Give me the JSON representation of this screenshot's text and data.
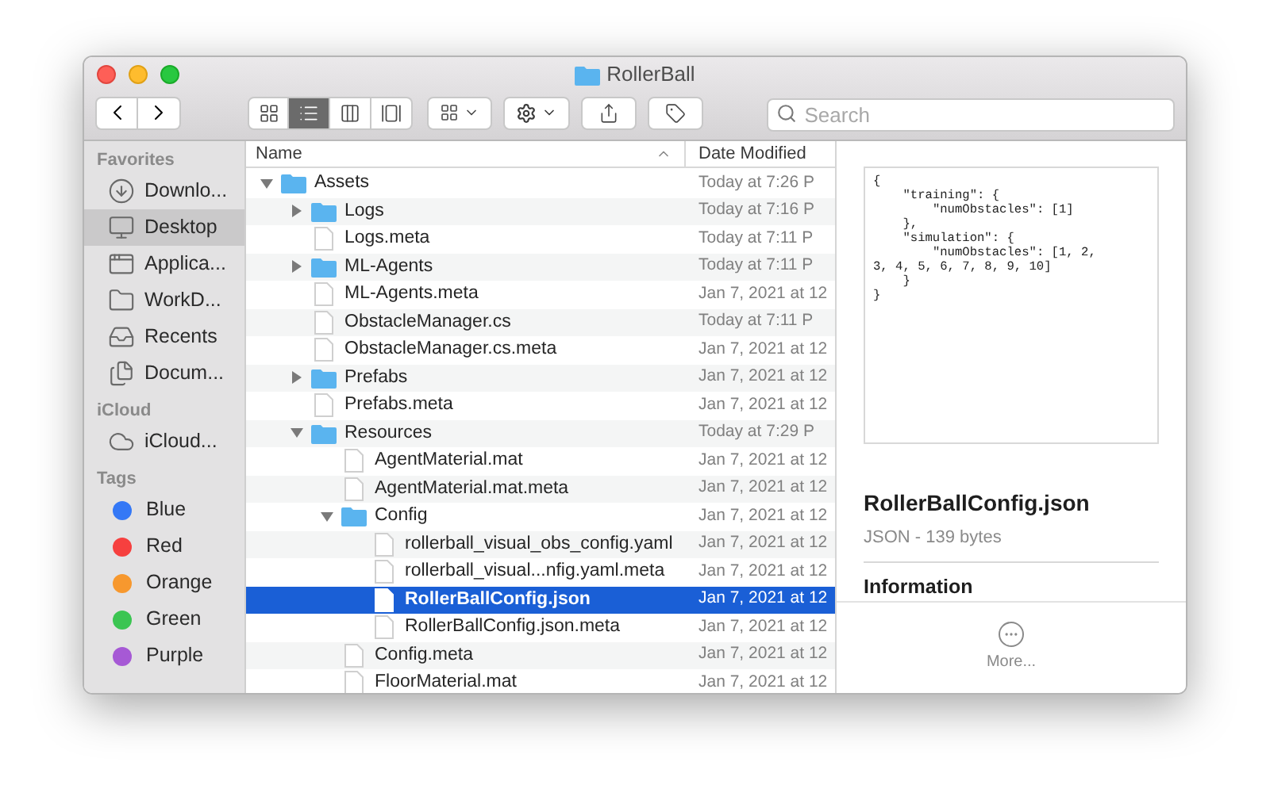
{
  "window": {
    "title": "RollerBall"
  },
  "toolbar": {
    "view_modes": [
      {
        "selected": false
      },
      {
        "selected": true
      },
      {
        "selected": false
      },
      {
        "selected": false
      }
    ],
    "search": {
      "placeholder": "Search"
    }
  },
  "sidebar": {
    "sections": [
      {
        "heading": "Favorites",
        "items": [
          {
            "label": "Downlo...",
            "kind": "downloads",
            "selected": false
          },
          {
            "label": "Desktop",
            "kind": "desktop",
            "selected": true
          },
          {
            "label": "Applica...",
            "kind": "applications",
            "selected": false
          },
          {
            "label": "WorkD...",
            "kind": "folder",
            "selected": false
          },
          {
            "label": "Recents",
            "kind": "recents",
            "selected": false
          },
          {
            "label": "Docum...",
            "kind": "documents",
            "selected": false
          }
        ]
      },
      {
        "heading": "iCloud",
        "items": [
          {
            "label": "iCloud...",
            "kind": "cloud",
            "selected": false
          }
        ]
      },
      {
        "heading": "Tags",
        "items": [
          {
            "label": "Blue",
            "kind": "tag",
            "color": "#3478f6",
            "selected": false
          },
          {
            "label": "Red",
            "kind": "tag",
            "color": "#f6403f",
            "selected": false
          },
          {
            "label": "Orange",
            "kind": "tag",
            "color": "#f7982e",
            "selected": false
          },
          {
            "label": "Green",
            "kind": "tag",
            "color": "#3bc552",
            "selected": false
          },
          {
            "label": "Purple",
            "kind": "tag",
            "color": "#a659d5",
            "selected": false
          }
        ]
      }
    ]
  },
  "file_list": {
    "columns": [
      "Name",
      "Date Modified"
    ],
    "rows": [
      {
        "name": "Assets",
        "date": "Today at 7:26 P",
        "kind": "folder",
        "expanded": true,
        "selected": false,
        "children": [
          {
            "name": "Logs",
            "date": "Today at 7:16 P",
            "kind": "folder",
            "expanded": false,
            "selected": false
          },
          {
            "name": "Logs.meta",
            "date": "Today at 7:11 P",
            "kind": "file",
            "selected": false
          },
          {
            "name": "ML-Agents",
            "date": "Today at 7:11 P",
            "kind": "folder",
            "expanded": false,
            "selected": false
          },
          {
            "name": "ML-Agents.meta",
            "date": "Jan 7, 2021 at 12",
            "kind": "file",
            "selected": false
          },
          {
            "name": "ObstacleManager.cs",
            "date": "Today at 7:11 P",
            "kind": "file",
            "selected": false
          },
          {
            "name": "ObstacleManager.cs.meta",
            "date": "Jan 7, 2021 at 12",
            "kind": "file",
            "selected": false
          },
          {
            "name": "Prefabs",
            "date": "Jan 7, 2021 at 12",
            "kind": "folder",
            "expanded": false,
            "selected": false
          },
          {
            "name": "Prefabs.meta",
            "date": "Jan 7, 2021 at 12",
            "kind": "file",
            "selected": false
          },
          {
            "name": "Resources",
            "date": "Today at 7:29 P",
            "kind": "folder",
            "expanded": true,
            "selected": false,
            "children": [
              {
                "name": "AgentMaterial.mat",
                "date": "Jan 7, 2021 at 12",
                "kind": "file",
                "selected": false
              },
              {
                "name": "AgentMaterial.mat.meta",
                "date": "Jan 7, 2021 at 12",
                "kind": "file",
                "selected": false
              },
              {
                "name": "Config",
                "date": "Jan 7, 2021 at 12",
                "kind": "folder",
                "expanded": true,
                "selected": false,
                "children": [
                  {
                    "name": "rollerball_visual_obs_config.yaml",
                    "date": "Jan 7, 2021 at 12",
                    "kind": "file",
                    "selected": false
                  },
                  {
                    "name": "rollerball_visual...nfig.yaml.meta",
                    "date": "Jan 7, 2021 at 12",
                    "kind": "file",
                    "selected": false
                  },
                  {
                    "name": "RollerBallConfig.json",
                    "date": "Jan 7, 2021 at 12",
                    "kind": "file",
                    "selected": true
                  },
                  {
                    "name": "RollerBallConfig.json.meta",
                    "date": "Jan 7, 2021 at 12",
                    "kind": "file",
                    "selected": false
                  }
                ]
              },
              {
                "name": "Config.meta",
                "date": "Jan 7, 2021 at 12",
                "kind": "file",
                "selected": false
              },
              {
                "name": "FloorMaterial.mat",
                "date": "Jan 7, 2021 at 12",
                "kind": "file",
                "selected": false
              }
            ]
          }
        ]
      }
    ]
  },
  "preview": {
    "content": "{\n    \"training\": {\n        \"numObstacles\": [1]\n    },\n    \"simulation\": {\n        \"numObstacles\": [1, 2,\n3, 4, 5, 6, 7, 8, 9, 10]\n    }\n}",
    "file_name": "RollerBallConfig.json",
    "details": "JSON - 139 bytes",
    "section_heading": "Information",
    "more_label": "More..."
  }
}
